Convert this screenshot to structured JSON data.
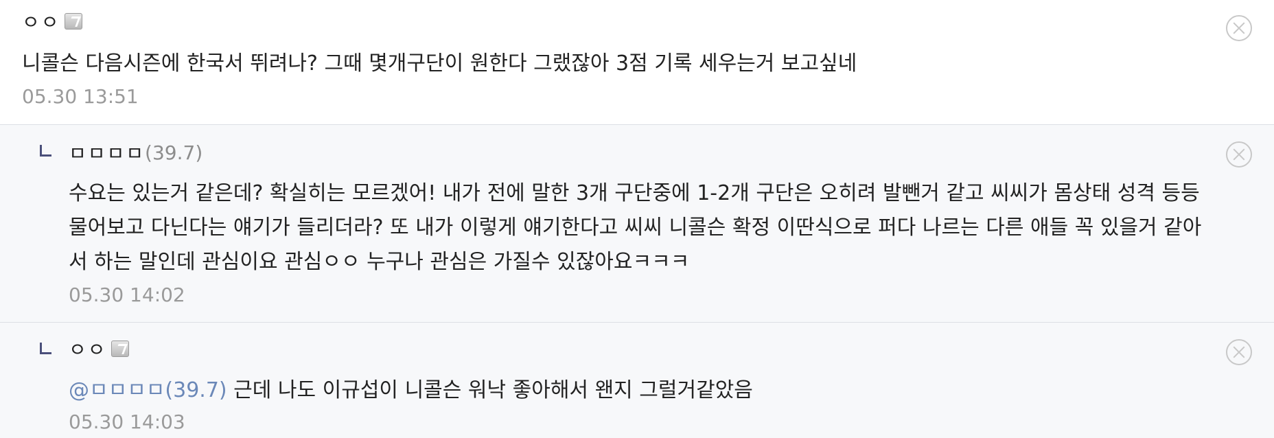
{
  "comments": [
    {
      "nickname": "ㅇㅇ",
      "text": "니콜슨 다음시즌에 한국서 뛰려나? 그때 몇개구단이 원한다 그랬잖아 3점 기록 세우는거 보고싶네",
      "time": "05.30 13:51"
    },
    {
      "nickname": "ㅁㅁㅁㅁ",
      "ip": "(39.7)",
      "text_lines": [
        "수요는 있는거 같은데? 확실히는 모르겠어! 내가 전에 말한 3개 구단중에 1-2개 구단은 오히려 발뺀거 같고 씨씨가 몸상태 성격 등등",
        "물어보고 다닌다는 얘기가 들리더라? 또 내가 이렇게 얘기한다고 씨씨 니콜슨 확정 이딴식으로 퍼다 나르는 다른 애들 꼭 있을거 같아",
        "서 하는 말인데 관심이요 관심ㅇㅇ 누구나 관심은 가질수 있잖아요ㅋㅋㅋ"
      ],
      "time": "05.30 14:02"
    },
    {
      "nickname": "ㅇㅇ",
      "mention": "@ㅁㅁㅁㅁ(39.7)",
      "text": "근데 나도 이규섭이 니콜슨 워낙 좋아해서 왠지 그럴거같았음",
      "time": "05.30 14:03"
    }
  ],
  "icons": {
    "close": "close-circle-icon",
    "reply": "reply-arrow-icon",
    "badge": "fixed-nick-badge-icon"
  },
  "colors": {
    "mention": "#6b88b8",
    "reply_bg": "#f7f8fa",
    "reply_mark": "#4a4f7a",
    "time": "#9a9a9a"
  }
}
